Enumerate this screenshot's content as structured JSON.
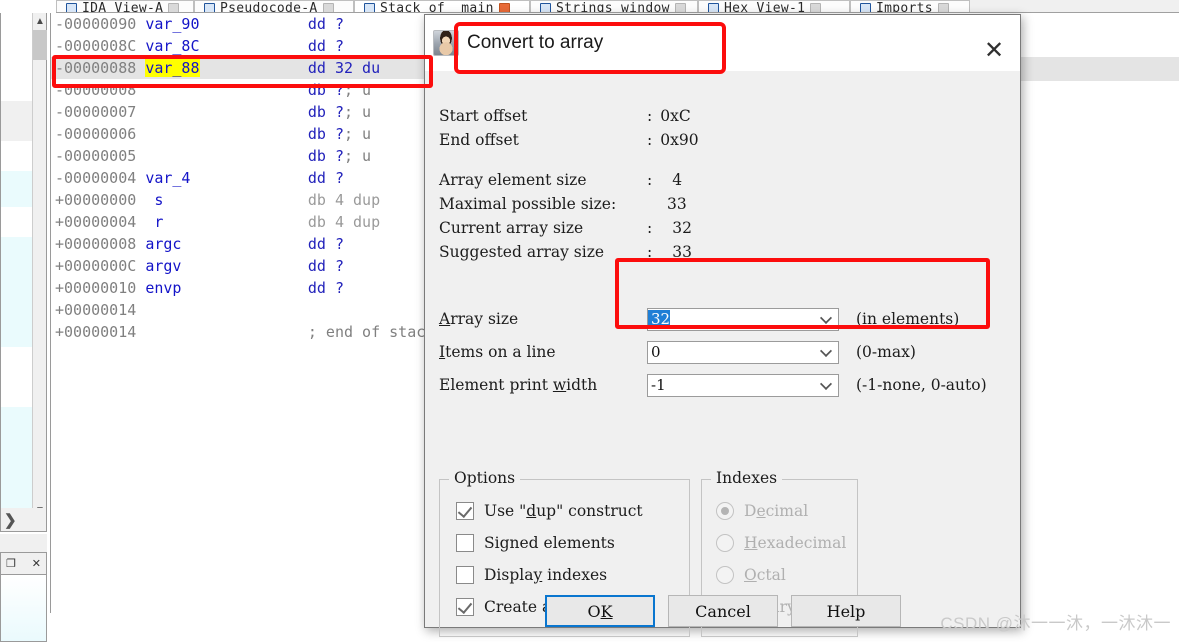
{
  "tabs": [
    {
      "label": "IDA View-A",
      "icon": "view-icon",
      "close": "close-box",
      "active": false
    },
    {
      "label": "Pseudocode-A",
      "icon": "view-icon",
      "close": "close-box",
      "active": false
    },
    {
      "label": "Stack of _main",
      "icon": "view-icon",
      "close": "close-box-orange",
      "active": true
    },
    {
      "label": "Strings window",
      "icon": "view-icon",
      "close": "close-box",
      "active": false
    },
    {
      "label": "Hex View-1",
      "icon": "view-icon",
      "close": "close-box",
      "active": false
    },
    {
      "label": "Imports",
      "icon": "view-icon",
      "close": "close-box",
      "active": false
    }
  ],
  "navigator": {
    "scroll_up_icon": "chevron-up-icon",
    "scroll_down_icon": "chevron-down-icon",
    "expand_icon": "chevron-right-icon",
    "restore_icon": "restore-window-icon",
    "close_icon": "close-icon"
  },
  "listing": {
    "rows": [
      {
        "addr": "-00000090",
        "name": "var_90",
        "op": "dd",
        "operand": "?",
        "comment": "",
        "highlighted": false,
        "name_highlight": false
      },
      {
        "addr": "-0000008C",
        "name": "var_8C",
        "op": "dd",
        "operand": "?",
        "comment": "",
        "highlighted": false,
        "name_highlight": false
      },
      {
        "addr": "-00000088",
        "name": "var_88",
        "op": "dd",
        "operand": "32 du",
        "comment": "",
        "highlighted": true,
        "name_highlight": true
      },
      {
        "addr": "-00000008",
        "name": "",
        "op": "db",
        "operand": "?",
        "comment": "; u",
        "highlighted": false,
        "name_highlight": false
      },
      {
        "addr": "-00000007",
        "name": "",
        "op": "db",
        "operand": "?",
        "comment": "; u",
        "highlighted": false,
        "name_highlight": false
      },
      {
        "addr": "-00000006",
        "name": "",
        "op": "db",
        "operand": "?",
        "comment": "; u",
        "highlighted": false,
        "name_highlight": false
      },
      {
        "addr": "-00000005",
        "name": "",
        "op": "db",
        "operand": "?",
        "comment": "; u",
        "highlighted": false,
        "name_highlight": false
      },
      {
        "addr": "-00000004",
        "name": "var_4",
        "op": "dd",
        "operand": "?",
        "comment": "",
        "highlighted": false,
        "name_highlight": false
      },
      {
        "addr": "+00000000",
        "name": " s",
        "op": "db",
        "operand": "4 dup",
        "comment": "",
        "highlighted": false,
        "name_highlight": false
      },
      {
        "addr": "+00000004",
        "name": " r",
        "op": "db",
        "operand": "4 dup",
        "comment": "",
        "highlighted": false,
        "name_highlight": false
      },
      {
        "addr": "+00000008",
        "name": "argc",
        "op": "dd",
        "operand": "?",
        "comment": "",
        "highlighted": false,
        "name_highlight": false
      },
      {
        "addr": "+0000000C",
        "name": "argv",
        "op": "dd",
        "operand": "?",
        "comment": "",
        "highlighted": false,
        "name_highlight": false
      },
      {
        "addr": "+00000010",
        "name": "envp",
        "op": "dd",
        "operand": "?",
        "comment": "",
        "highlighted": false,
        "name_highlight": false
      },
      {
        "addr": "+00000014",
        "name": "",
        "op": "",
        "operand": "",
        "comment": "",
        "highlighted": false,
        "name_highlight": false
      },
      {
        "addr": "+00000014",
        "name": "",
        "op": "",
        "operand": "",
        "comment": "; end of stack variables",
        "highlighted": false,
        "name_highlight": false
      }
    ]
  },
  "dialog": {
    "title": "Convert to array",
    "icon": "ida-portrait-icon",
    "close_icon": "close-icon",
    "info": [
      {
        "label": "Start offset",
        "sep": ":",
        "value": "0xC"
      },
      {
        "label": "End offset",
        "sep": ":",
        "value": "0x90"
      }
    ],
    "sizes": [
      {
        "label": "Array element size",
        "sep": ":",
        "value": "4"
      },
      {
        "label": "Maximal possible size:",
        "sep": "",
        "value": "33"
      },
      {
        "label": "Current array size",
        "sep": ":",
        "value": "32"
      },
      {
        "label": "Suggested array size",
        "sep": ":",
        "value": "33"
      }
    ],
    "fields": [
      {
        "label_pre": "",
        "label_key": "A",
        "label_post": "rray size",
        "value": "32",
        "selected": true,
        "suffix": "(in elements)",
        "name": "array-size"
      },
      {
        "label_pre": "",
        "label_key": "I",
        "label_post": "tems on a line",
        "value": "0",
        "selected": false,
        "suffix": "(0-max)",
        "name": "items-on-a-line"
      },
      {
        "label_pre": "Element print ",
        "label_key": "w",
        "label_post": "idth",
        "value": "-1",
        "selected": false,
        "suffix": "(-1-none, 0-auto)",
        "name": "element-print-width"
      }
    ],
    "options": {
      "legend": "Options",
      "items": [
        {
          "pre": "Use \"",
          "key": "d",
          "post": "up\" construct",
          "checked": true,
          "name": "use-dup-construct"
        },
        {
          "pre": "Si",
          "key": "g",
          "post": "ned elements",
          "checked": false,
          "name": "signed-elements"
        },
        {
          "pre": "Displa",
          "key": "y",
          "post": " indexes",
          "checked": false,
          "name": "display-indexes"
        },
        {
          "pre": "Create as a",
          "key": "r",
          "post": "ray",
          "checked": true,
          "name": "create-as-array"
        }
      ]
    },
    "indexes": {
      "legend": "Indexes",
      "disabled": true,
      "items": [
        {
          "pre": "D",
          "key": "e",
          "post": "cimal",
          "selected": true,
          "name": "decimal"
        },
        {
          "pre": "",
          "key": "H",
          "post": "exadecimal",
          "selected": false,
          "name": "hexadecimal"
        },
        {
          "pre": "",
          "key": "O",
          "post": "ctal",
          "selected": false,
          "name": "octal"
        },
        {
          "pre": "",
          "key": "B",
          "post": "inary",
          "selected": false,
          "name": "binary"
        }
      ]
    },
    "buttons": [
      {
        "pre": "O",
        "key": "K",
        "post": "",
        "default": true,
        "name": "ok"
      },
      {
        "pre": "Cancel",
        "key": "",
        "post": "",
        "default": false,
        "name": "cancel"
      },
      {
        "pre": "Help",
        "key": "",
        "post": "",
        "default": false,
        "name": "help"
      }
    ]
  },
  "annotations": {
    "color": "#fc0d0d",
    "boxes": [
      "stack-row-var_88",
      "dialog-title",
      "array-size-field"
    ]
  },
  "watermark": "CSDN @沐一一沐，一沐沐一"
}
